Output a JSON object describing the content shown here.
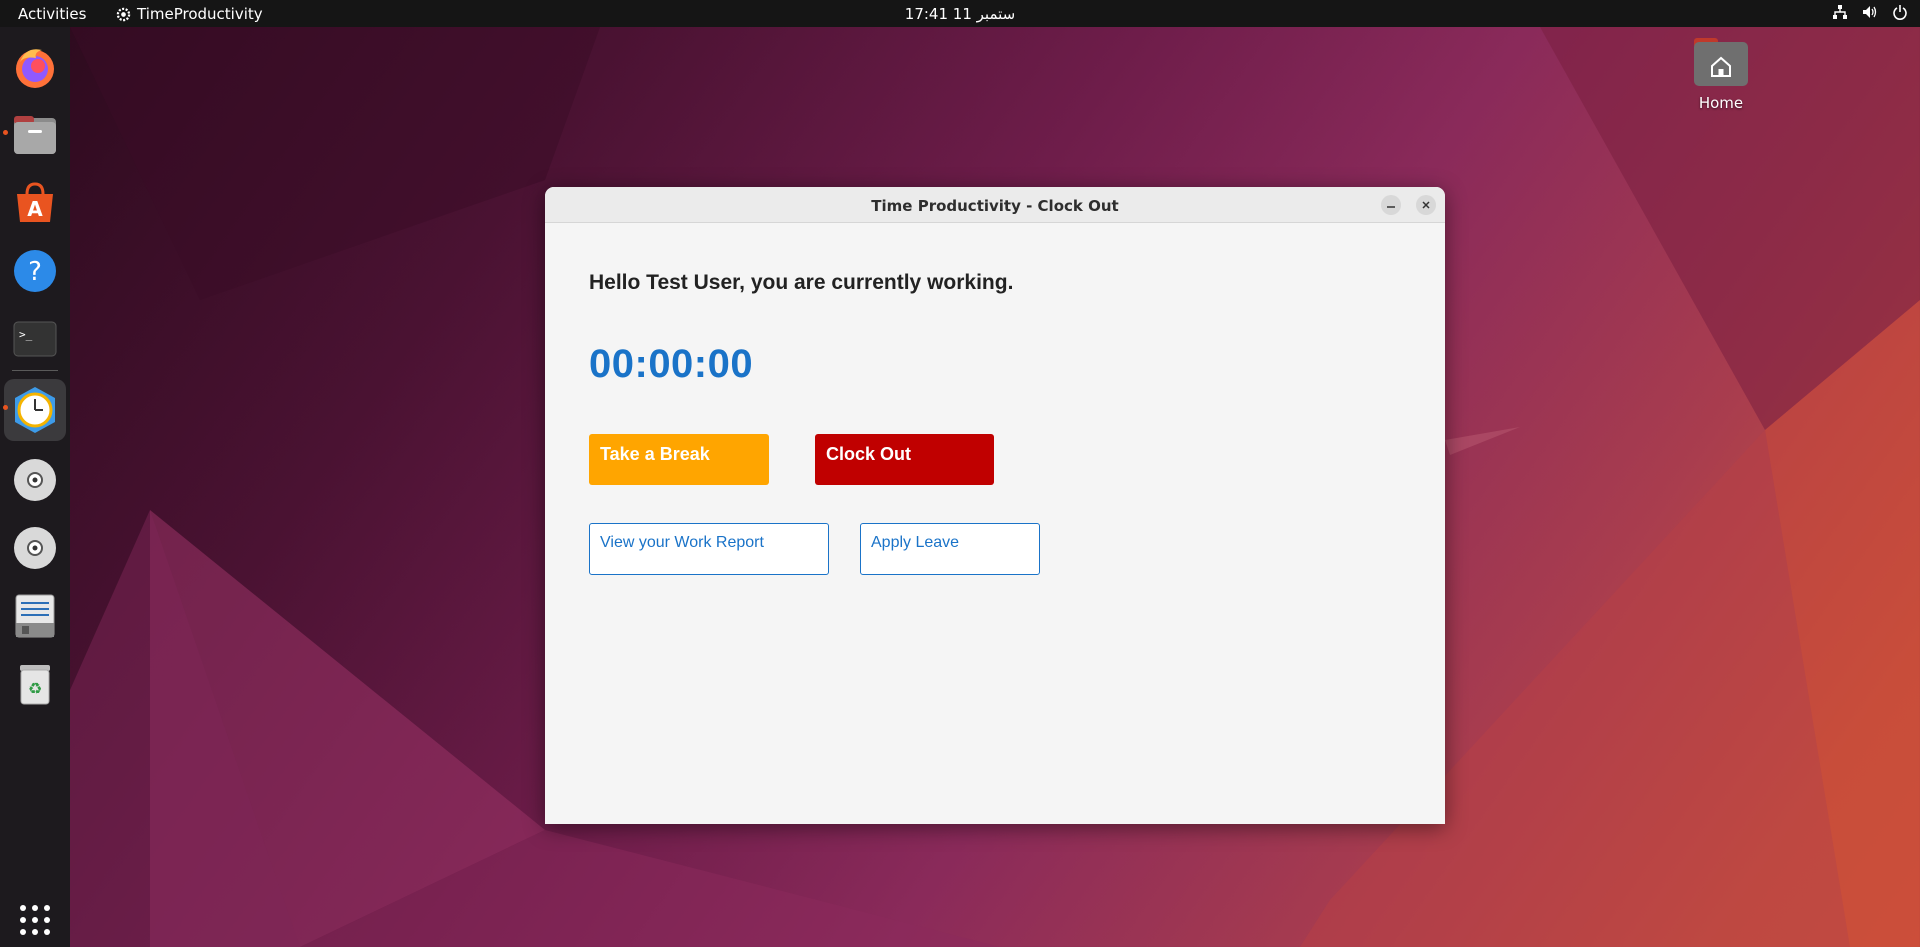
{
  "topbar": {
    "activities": "Activities",
    "app_name": "TimeProductivity",
    "clock": "17:41  11 ستمبر"
  },
  "dock": {
    "items": [
      {
        "name": "firefox-icon"
      },
      {
        "name": "files-icon"
      },
      {
        "name": "app-center-icon"
      },
      {
        "name": "help-icon"
      },
      {
        "name": "terminal-icon"
      },
      {
        "name": "time-productivity-icon"
      },
      {
        "name": "disc-icon"
      },
      {
        "name": "disc-icon"
      },
      {
        "name": "text-editor-icon"
      },
      {
        "name": "trash-icon"
      },
      {
        "name": "show-apps-icon"
      }
    ]
  },
  "desktop": {
    "home_label": "Home"
  },
  "window": {
    "title": "Time Productivity - Clock Out",
    "greeting": "Hello Test User, you are currently working.",
    "timer": "00:00:00",
    "break_label": "Take a Break",
    "clockout_label": "Clock Out",
    "report_label": "View your Work Report",
    "leave_label": "Apply Leave"
  },
  "colors": {
    "accent_blue": "#1a73c8",
    "break_orange": "#ffa500",
    "clockout_red": "#c00000",
    "ubuntu_orange": "#e95420"
  }
}
